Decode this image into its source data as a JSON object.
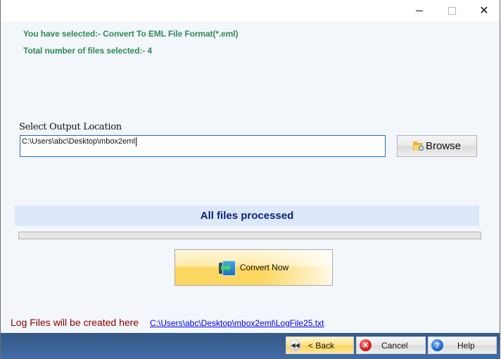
{
  "window": {
    "controls": {
      "minimize": "minimize",
      "maximize": "maximize",
      "close": "close"
    }
  },
  "info": {
    "selected_format": "You have selected:- Convert To EML File Format(*.eml)",
    "total_files": "Total number of files selected:- 4"
  },
  "output": {
    "label": "Select Output Location",
    "path_value": "C:\\Users\\abc\\Desktop\\mbox2eml",
    "browse_label": "Browse"
  },
  "status": {
    "message": "All files processed",
    "progress_percent": 0
  },
  "convert": {
    "label": "Convert Now"
  },
  "log": {
    "label": "Log Files will be created here",
    "path": "C:\\Users\\abc\\Desktop\\mbox2eml\\LogFile25.txt"
  },
  "footer": {
    "back_label": "< Back",
    "cancel_label": "Cancel",
    "help_label": "Help"
  },
  "colors": {
    "info_text": "#2e8b57",
    "status_text": "#0f1f7a",
    "log_label": "#8b0000",
    "link": "#0000ee",
    "bottom_bar": "#3d6499"
  }
}
